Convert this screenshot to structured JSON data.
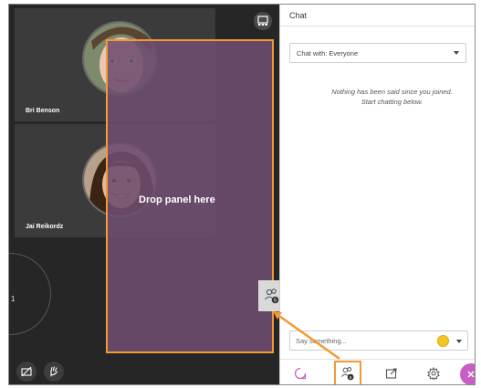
{
  "stage": {
    "participants": [
      {
        "name": "Bri Benson"
      },
      {
        "name": "Jai Reikordz"
      }
    ],
    "round_tile_number": "1",
    "drop_panel_text": "Drop panel here"
  },
  "chat_panel": {
    "title": "Chat",
    "chat_with_value": "Chat with: Everyone",
    "empty_line1": "Nothing has been said since you joined.",
    "empty_line2": "Start chatting below.",
    "message_placeholder": "Say something..."
  },
  "tabs": [
    {
      "icon": "chat-icon"
    },
    {
      "icon": "attendees-icon",
      "badge": "5"
    },
    {
      "icon": "share-content-icon"
    },
    {
      "icon": "gear-icon"
    }
  ],
  "colors": {
    "highlight": "#f29a33",
    "drop_panel": "#6e4c70",
    "close_fab": "#c75fc4",
    "stage_bg": "#262626"
  },
  "drag_ghost_badge": "5"
}
